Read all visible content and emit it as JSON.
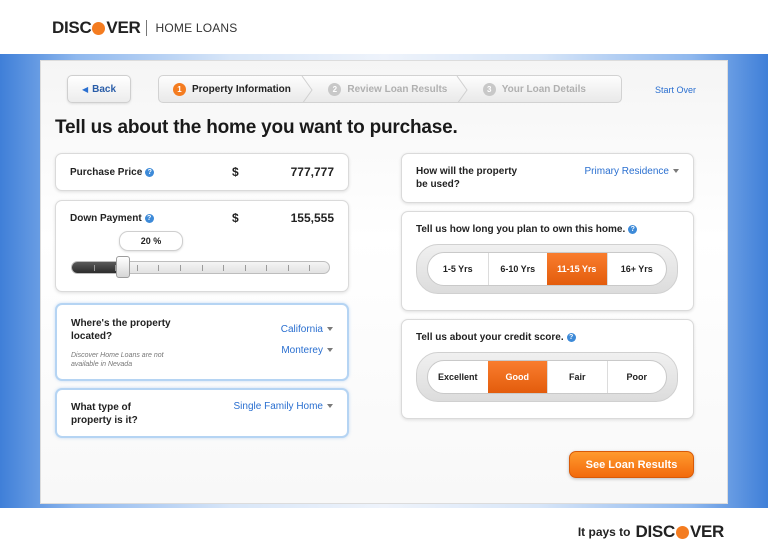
{
  "brand": {
    "logo_left": "DISC",
    "logo_right": "VER",
    "subtitle": "HOME LOANS",
    "footer_tagline": "It pays to",
    "footer_left": "DISC",
    "footer_right": "VER"
  },
  "colors": {
    "accent": "#f47c20",
    "link": "#2a6fd0",
    "backdrop": "#3f7fd8"
  },
  "nav": {
    "back_label": "Back",
    "start_over": "Start Over",
    "steps": [
      {
        "num": "1",
        "label": "Property Information",
        "active": true
      },
      {
        "num": "2",
        "label": "Review Loan Results",
        "active": false
      },
      {
        "num": "3",
        "label": "Your Loan Details",
        "active": false
      }
    ]
  },
  "headline": "Tell us about the home you want to purchase.",
  "purchase_price": {
    "label": "Purchase Price",
    "currency": "$",
    "value": "777,777"
  },
  "down_payment": {
    "label": "Down Payment",
    "currency": "$",
    "value": "155,555",
    "percent_label": "20 %",
    "percent": 20
  },
  "location": {
    "label_line1": "Where's the property",
    "label_line2": "located?",
    "state": "California",
    "city": "Monterey",
    "note_line1": "Discover Home Loans are not",
    "note_line2": "available in Nevada"
  },
  "property_type": {
    "label_line1": "What type of",
    "label_line2": "property is it?",
    "value": "Single Family Home"
  },
  "usage": {
    "label_line1": "How will the property",
    "label_line2": "be used?",
    "value": "Primary Residence"
  },
  "ownership": {
    "label": "Tell us how long you plan to own this home.",
    "options": [
      "1-5 Yrs",
      "6-10 Yrs",
      "11-15 Yrs",
      "16+ Yrs"
    ],
    "selected": 2
  },
  "credit": {
    "label": "Tell us about your credit score.",
    "options": [
      "Excellent",
      "Good",
      "Fair",
      "Poor"
    ],
    "selected": 1
  },
  "help_glyph": "?",
  "cta_label": "See Loan Results"
}
